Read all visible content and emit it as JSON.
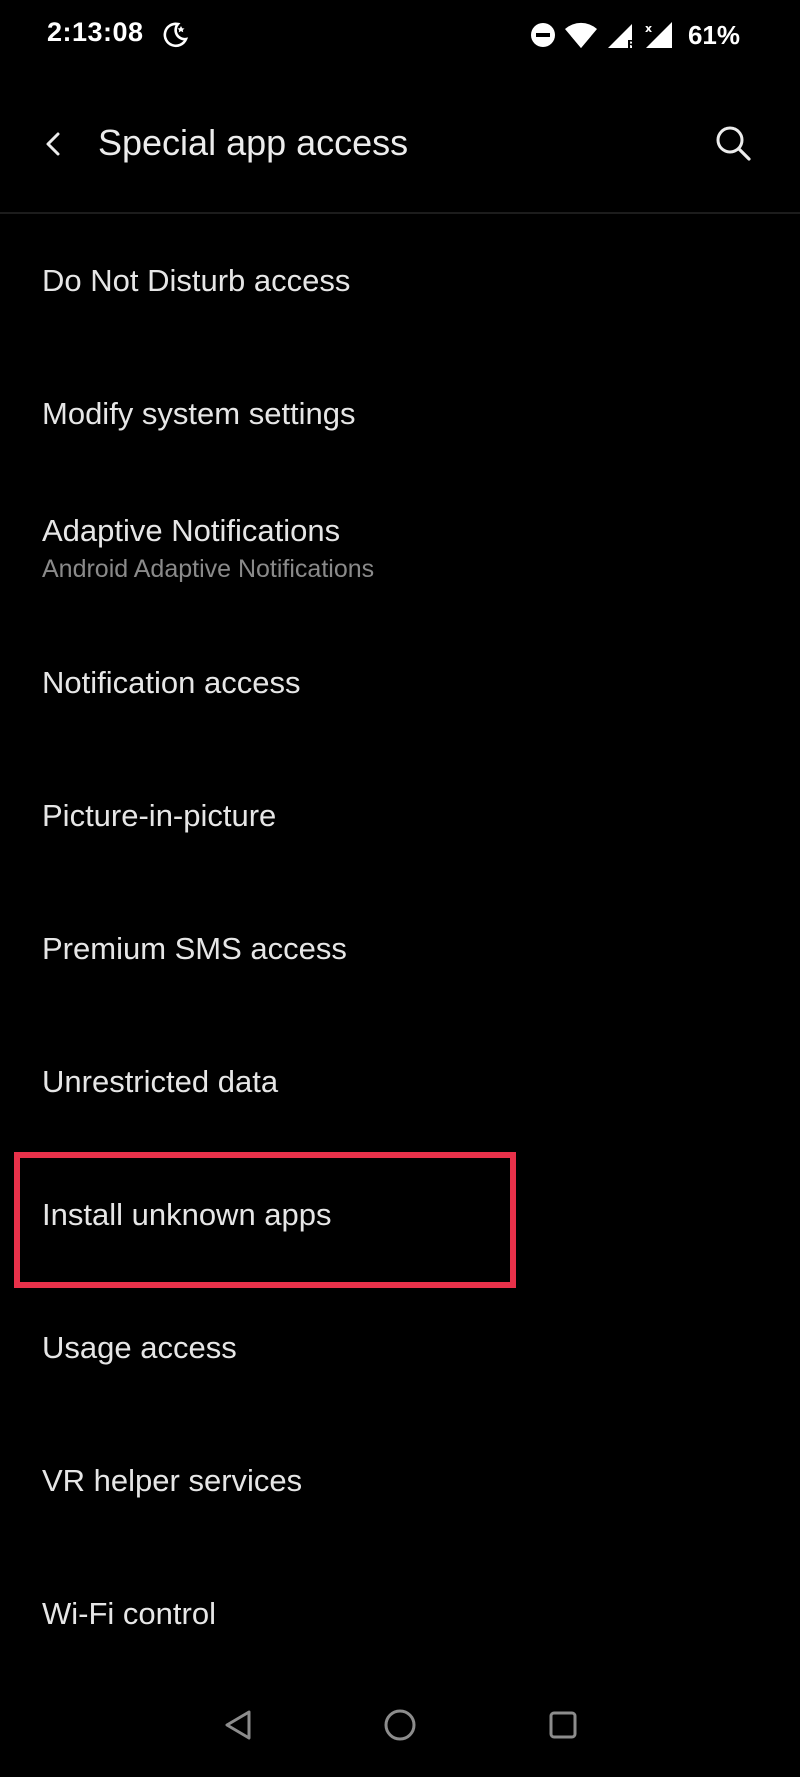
{
  "status_bar": {
    "time": "2:13:08",
    "battery": "61%",
    "icons": [
      "moon-icon",
      "dnd-icon",
      "wifi-icon",
      "signal-r-icon",
      "signal-x-icon"
    ]
  },
  "app_bar": {
    "title": "Special app access",
    "back_icon": "chevron-left-icon",
    "search_icon": "search-icon"
  },
  "items": [
    {
      "title": "Do Not Disturb access",
      "subtitle": ""
    },
    {
      "title": "Modify system settings",
      "subtitle": ""
    },
    {
      "title": "Adaptive Notifications",
      "subtitle": "Android Adaptive Notifications"
    },
    {
      "title": "Notification access",
      "subtitle": ""
    },
    {
      "title": "Picture-in-picture",
      "subtitle": ""
    },
    {
      "title": "Premium SMS access",
      "subtitle": ""
    },
    {
      "title": "Unrestricted data",
      "subtitle": ""
    },
    {
      "title": "Install unknown apps",
      "subtitle": ""
    },
    {
      "title": "Usage access",
      "subtitle": ""
    },
    {
      "title": "VR helper services",
      "subtitle": ""
    },
    {
      "title": "Wi-Fi control",
      "subtitle": ""
    }
  ],
  "colors": {
    "background": "#000000",
    "text": "#e6e6e6",
    "subtext": "#8a8a8a",
    "highlight": "#e8314a"
  },
  "nav_bar": {
    "icons": [
      "triangle-back-icon",
      "circle-home-icon",
      "square-recents-icon"
    ]
  }
}
